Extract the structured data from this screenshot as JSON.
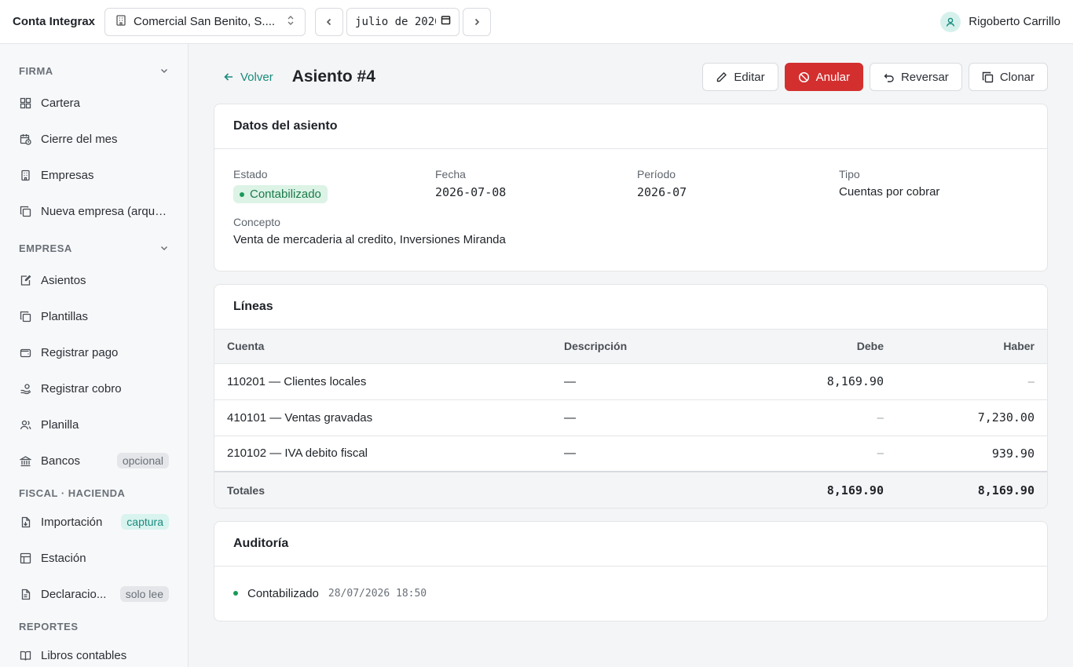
{
  "header": {
    "brand": "Conta Integrax",
    "company": "Comercial San Benito, S....",
    "period_value": "julio de 2026",
    "user": "Rigoberto Carrillo"
  },
  "sidebar": {
    "sections": [
      {
        "title": "FIRMA",
        "items": [
          {
            "label": "Cartera",
            "icon": "grid-icon"
          },
          {
            "label": "Cierre del mes",
            "icon": "calendar-clock-icon"
          },
          {
            "label": "Empresas",
            "icon": "building-icon"
          },
          {
            "label": "Nueva empresa (arque...",
            "icon": "copy-icon"
          }
        ]
      },
      {
        "title": "EMPRESA",
        "items": [
          {
            "label": "Asientos",
            "icon": "edit-note-icon"
          },
          {
            "label": "Plantillas",
            "icon": "copy-icon"
          },
          {
            "label": "Registrar pago",
            "icon": "wallet-icon"
          },
          {
            "label": "Registrar cobro",
            "icon": "hand-coins-icon"
          },
          {
            "label": "Planilla",
            "icon": "users-icon"
          },
          {
            "label": "Bancos",
            "icon": "bank-icon",
            "badge": "opcional"
          }
        ]
      },
      {
        "title": "FISCAL · HACIENDA",
        "items": [
          {
            "label": "Importación",
            "icon": "file-import-icon",
            "badge": "captura"
          },
          {
            "label": "Estación",
            "icon": "table-icon"
          },
          {
            "label": "Declaracio...",
            "icon": "file-text-icon",
            "badge": "solo lee"
          }
        ]
      },
      {
        "title": "REPORTES",
        "items": [
          {
            "label": "Libros contables",
            "icon": "book-icon"
          }
        ]
      }
    ]
  },
  "page": {
    "back_label": "Volver",
    "title": "Asiento #4",
    "actions": {
      "edit": "Editar",
      "void": "Anular",
      "reverse": "Reversar",
      "clone": "Clonar"
    }
  },
  "datos": {
    "title": "Datos del asiento",
    "estado_label": "Estado",
    "estado_value": "Contabilizado",
    "fecha_label": "Fecha",
    "fecha_value": "2026-07-08",
    "periodo_label": "Período",
    "periodo_value": "2026-07",
    "tipo_label": "Tipo",
    "tipo_value": "Cuentas por cobrar",
    "concepto_label": "Concepto",
    "concepto_value": "Venta de mercaderia al credito, Inversiones Miranda"
  },
  "lineas": {
    "title": "Líneas",
    "columns": [
      "Cuenta",
      "Descripción",
      "Debe",
      "Haber"
    ],
    "rows": [
      {
        "cuenta": "110201 — Clientes locales",
        "descripcion": "—",
        "debe": "8,169.90",
        "haber": "–"
      },
      {
        "cuenta": "410101 — Ventas gravadas",
        "descripcion": "—",
        "debe": "–",
        "haber": "7,230.00"
      },
      {
        "cuenta": "210102 — IVA debito fiscal",
        "descripcion": "—",
        "debe": "–",
        "haber": "939.90"
      }
    ],
    "totals_label": "Totales",
    "total_debe": "8,169.90",
    "total_haber": "8,169.90"
  },
  "auditoria": {
    "title": "Auditoría",
    "event": "Contabilizado",
    "timestamp": "28/07/2026 18:50"
  },
  "colors": {
    "accent": "#1a8a7c",
    "danger": "#d32f2f",
    "success": "#1b9a5a"
  }
}
